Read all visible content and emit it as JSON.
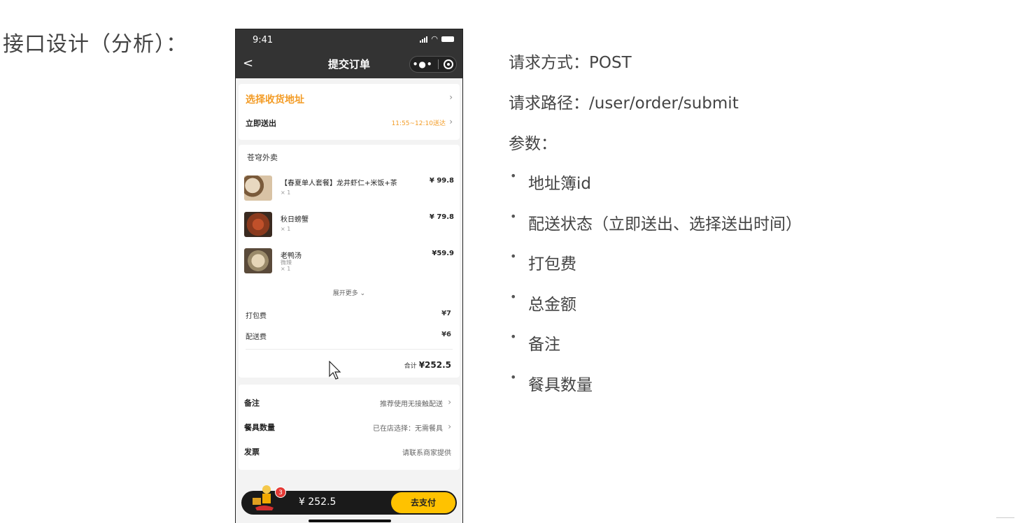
{
  "slide": {
    "title": "接口设计（分析）："
  },
  "phone": {
    "status_time": "9:41",
    "nav_title": "提交订单",
    "address": {
      "title": "选择收货地址",
      "deliver_label": "立即送出",
      "deliver_time": "11:55~12:10送达"
    },
    "order": {
      "shop_name": "苍穹外卖",
      "items": [
        {
          "name": "【春夏单人套餐】龙井虾仁+米饭+茶",
          "sub": "",
          "qty": "× 1",
          "price": "¥ 99.8"
        },
        {
          "name": "秋日螃蟹",
          "sub": "",
          "qty": "× 1",
          "price": "¥ 79.8"
        },
        {
          "name": "老鸭汤",
          "sub": "微辣",
          "qty": "× 1",
          "price": "¥59.9"
        }
      ],
      "expand_more": "展开更多",
      "packing_fee_label": "打包费",
      "packing_fee_value": "¥7",
      "delivery_fee_label": "配送费",
      "delivery_fee_value": "¥6",
      "total_label": "合计",
      "total_value": "¥252.5"
    },
    "extra": {
      "remark_label": "备注",
      "remark_value": "推荐使用无接触配送",
      "tableware_label": "餐具数量",
      "tableware_value": "已在店选择：无需餐具",
      "invoice_label": "发票",
      "invoice_value": "请联系商家提供"
    },
    "pay_bar": {
      "badge": "3",
      "amount": "¥ 252.5",
      "pay_button": "去支付"
    }
  },
  "api": {
    "method": "请求方式：POST",
    "path": "请求路径：/user/order/submit",
    "params_label": "参数：",
    "params": [
      "地址簿id",
      "配送状态（立即送出、选择送出时间）",
      "打包费",
      "总金额",
      "备注",
      "餐具数量"
    ]
  },
  "colors": {
    "accent": "#f39c26",
    "pay_button": "#ffc200",
    "header": "#333333"
  }
}
